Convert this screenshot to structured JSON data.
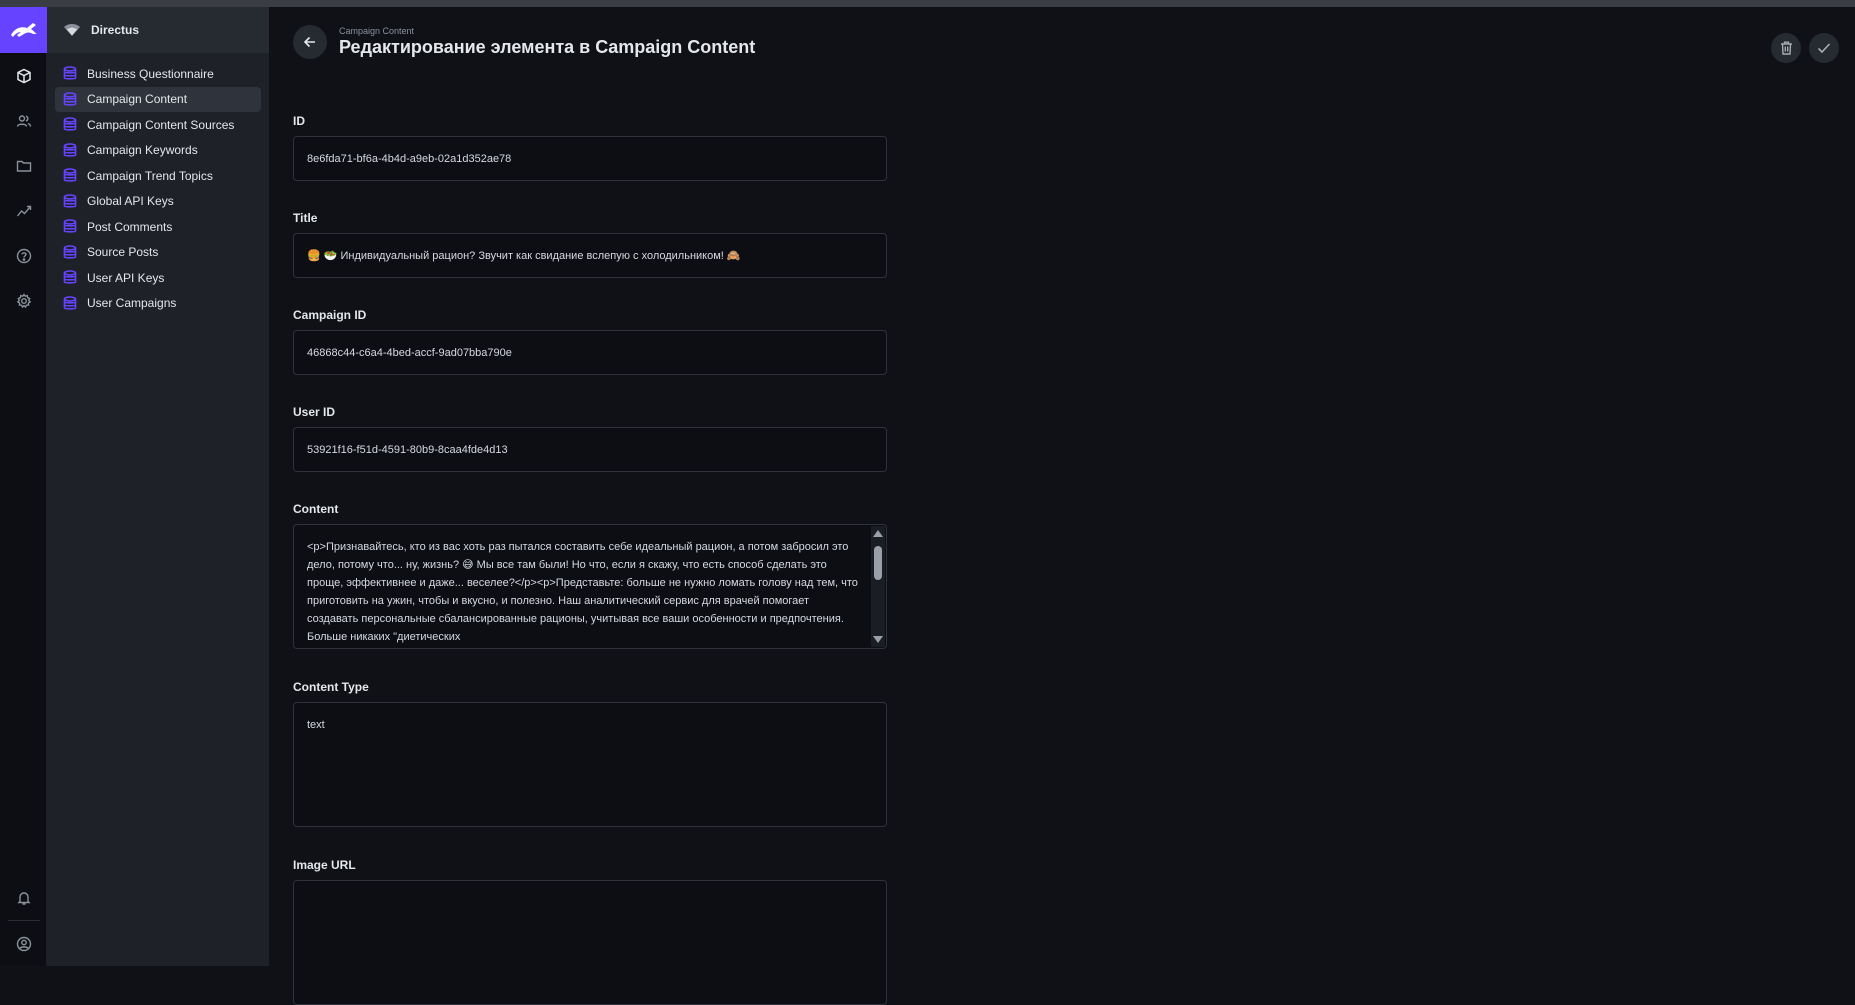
{
  "app": {
    "project_name": "Directus",
    "brand_color": "#6644ff"
  },
  "nav": {
    "items": [
      {
        "label": "Business Questionnaire",
        "active": false
      },
      {
        "label": "Campaign Content",
        "active": true
      },
      {
        "label": "Campaign Content Sources",
        "active": false
      },
      {
        "label": "Campaign Keywords",
        "active": false
      },
      {
        "label": "Campaign Trend Topics",
        "active": false
      },
      {
        "label": "Global API Keys",
        "active": false
      },
      {
        "label": "Post Comments",
        "active": false
      },
      {
        "label": "Source Posts",
        "active": false
      },
      {
        "label": "User API Keys",
        "active": false
      },
      {
        "label": "User Campaigns",
        "active": false
      }
    ]
  },
  "header": {
    "breadcrumb": "Campaign Content",
    "title": "Редактирование элемента в Campaign Content"
  },
  "fields": {
    "id": {
      "label": "ID",
      "value": "8e6fda71-bf6a-4b4d-a9eb-02a1d352ae78"
    },
    "title": {
      "label": "Title",
      "value": "🍔 🥗 Индивидуальный рацион? Звучит как свидание вслепую с холодильником! 🙈"
    },
    "campaign_id": {
      "label": "Campaign ID",
      "value": "46868c44-c6a4-4bed-accf-9ad07bba790e"
    },
    "user_id": {
      "label": "User ID",
      "value": "53921f16-f51d-4591-80b9-8caa4fde4d13"
    },
    "content": {
      "label": "Content",
      "value": "<p>Признавайтесь, кто из вас хоть раз пытался составить себе идеальный рацион, а потом забросил это дело, потому что... ну, жизнь? 😅 Мы все там были! Но что, если я скажу, что есть способ сделать это проще, эффективнее и даже... веселее?</p><p>Представьте: больше не нужно ломать голову над тем, что приготовить на ужин, чтобы и вкусно, и полезно. Наш аналитический сервис для врачей помогает создавать персональные сбалансированные рационы, учитывая все ваши особенности и предпочтения. Больше никаких \"диетических"
    },
    "content_type": {
      "label": "Content Type",
      "value": "text"
    },
    "image_url": {
      "label": "Image URL",
      "value": ""
    }
  }
}
